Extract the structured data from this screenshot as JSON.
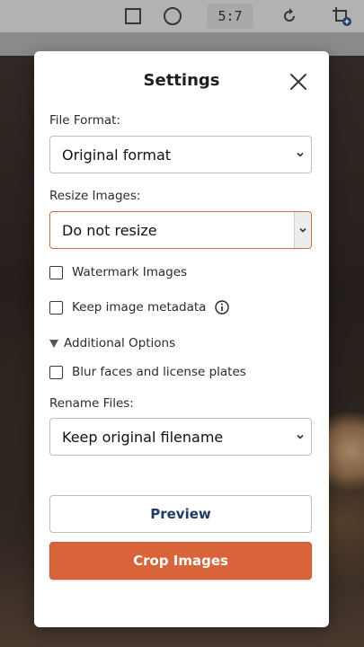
{
  "toolbar": {
    "ratio_label": "5:7",
    "icons": [
      "square-icon",
      "circle-icon",
      "rotate-icon",
      "crop-add-icon"
    ]
  },
  "dialog": {
    "title": "Settings",
    "file_format": {
      "label": "File Format:",
      "value": "Original format"
    },
    "resize": {
      "label": "Resize Images:",
      "value": "Do not resize"
    },
    "watermark": {
      "label": "Watermark Images",
      "checked": false
    },
    "metadata": {
      "label": "Keep image metadata",
      "checked": false
    },
    "additional_options": {
      "label": "Additional Options",
      "expanded": true
    },
    "blur": {
      "label": "Blur faces and license plates",
      "checked": false
    },
    "rename": {
      "label": "Rename Files:",
      "value": "Keep original filename"
    },
    "preview_label": "Preview",
    "crop_label": "Crop Images"
  },
  "colors": {
    "accent": "#d9643a",
    "preview_text": "#1f3a66",
    "active_border": "#d06a48"
  }
}
